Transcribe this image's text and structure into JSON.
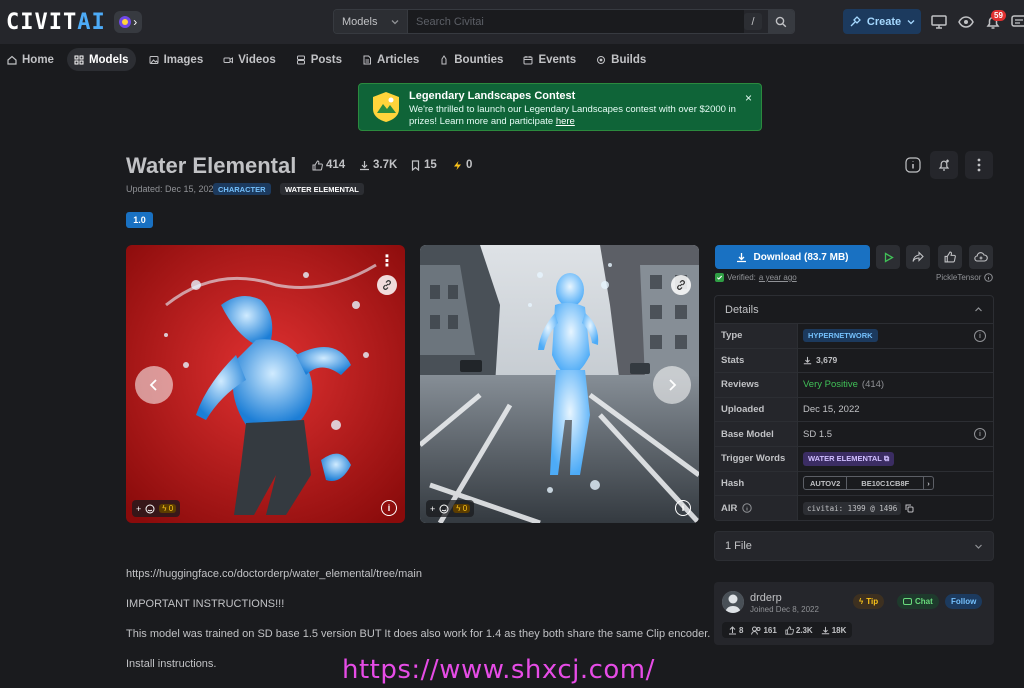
{
  "header": {
    "logo": {
      "part1": "CIVIT",
      "part2": "AI"
    },
    "search": {
      "scope": "Models",
      "placeholder": "Search Civitai",
      "shortcut": "/"
    },
    "create_label": "Create",
    "notification_count": "59"
  },
  "nav": {
    "items": [
      {
        "label": "Home",
        "icon": "home-icon"
      },
      {
        "label": "Models",
        "icon": "grid-icon",
        "active": true
      },
      {
        "label": "Images",
        "icon": "image-icon"
      },
      {
        "label": "Videos",
        "icon": "video-icon"
      },
      {
        "label": "Posts",
        "icon": "posts-icon"
      },
      {
        "label": "Articles",
        "icon": "article-icon"
      },
      {
        "label": "Bounties",
        "icon": "bounty-icon"
      },
      {
        "label": "Events",
        "icon": "calendar-icon"
      },
      {
        "label": "Builds",
        "icon": "builds-icon"
      }
    ]
  },
  "banner": {
    "title": "Legendary Landscapes Contest",
    "text": "We're thrilled to launch our Legendary Landscapes contest with over $2000 in prizes! Learn more and participate",
    "link": "here",
    "close": "×"
  },
  "model": {
    "title": "Water Elemental",
    "likes": "414",
    "downloads": "3.7K",
    "saves": "15",
    "buzz": "0",
    "updated": "Updated: Dec 15, 2022",
    "tags": [
      "CHARACTER",
      "WATER ELEMENTAL"
    ],
    "version": "1.0"
  },
  "gallery": {
    "cards": [
      {
        "buzz": "0",
        "alt": "red background water figure"
      },
      {
        "buzz": "0",
        "alt": "city street water figure"
      }
    ]
  },
  "actions": {
    "download_label": "Download (83.7 MB)",
    "verified_label": "Verified:",
    "verified_time": "a year ago",
    "scanner": "PickleTensor"
  },
  "details": {
    "header": "Details",
    "rows": [
      {
        "key": "Type",
        "value": "HYPERNETWORK"
      },
      {
        "key": "Stats",
        "value": "3,679"
      },
      {
        "key": "Reviews",
        "value": "Very Positive",
        "count": "(414)"
      },
      {
        "key": "Uploaded",
        "value": "Dec 15, 2022"
      },
      {
        "key": "Base Model",
        "value": "SD 1.5"
      },
      {
        "key": "Trigger Words",
        "value": "WATER ELEMENTAL"
      },
      {
        "key": "Hash",
        "algo": "AUTOV2",
        "value": "BE10C1CB8F"
      },
      {
        "key": "AIR",
        "value": "civitai: 1399 @ 1496"
      }
    ]
  },
  "files": {
    "label": "1 File"
  },
  "creator": {
    "name": "drderp",
    "joined": "Joined Dec 8, 2022",
    "tip": "Tip",
    "chat": "Chat",
    "follow": "Follow",
    "stats": {
      "uploads": "8",
      "followers": "161",
      "likes": "2.3K",
      "downloads": "18K"
    }
  },
  "description": {
    "lines": [
      "https://huggingface.co/doctorderp/water_elemental/tree/main",
      "IMPORTANT INSTRUCTIONS!!!",
      "This model was trained on SD base 1.5 version BUT It does also work for 1.4 as they both share the same Clip encoder.",
      "Install instructions."
    ]
  },
  "watermark": "https://www.shxcj.com/",
  "colors": {
    "accent": "#1971c2",
    "banner": "#0f6438",
    "background": "#1a1b1e"
  }
}
